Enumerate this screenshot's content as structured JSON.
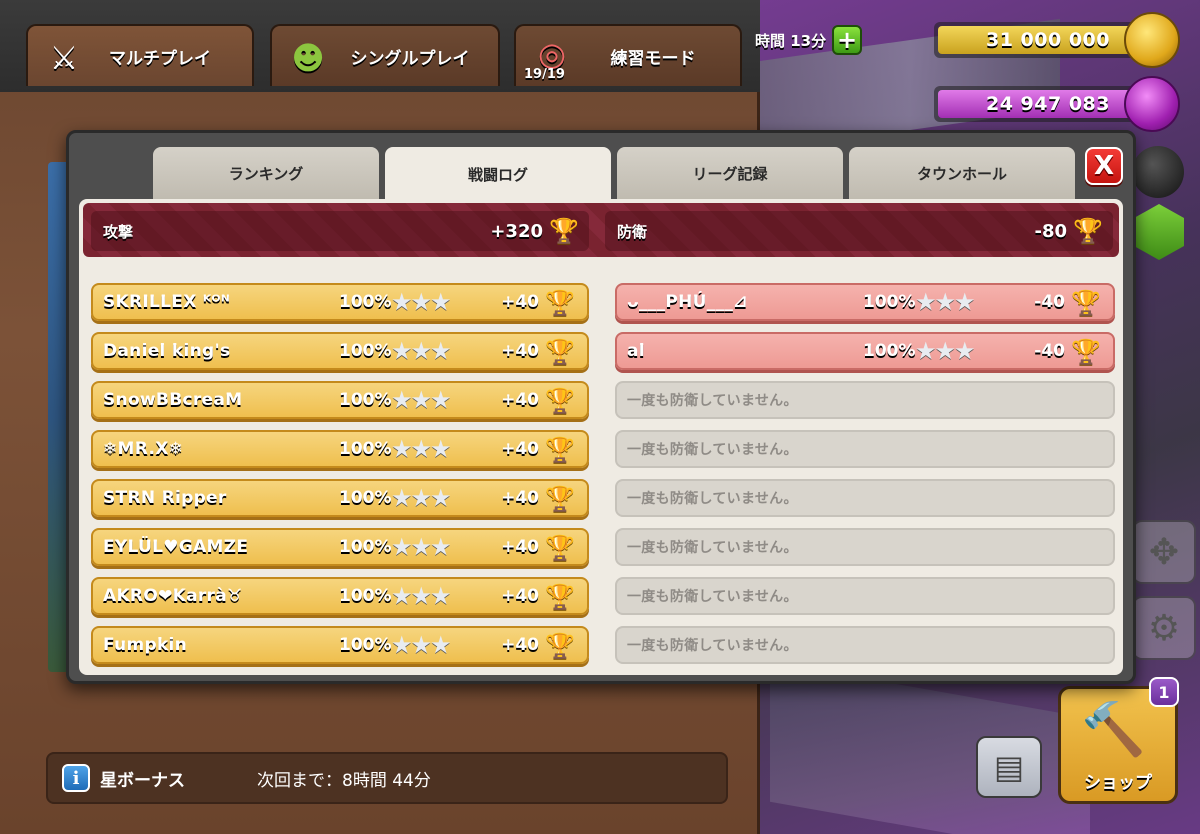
{
  "top_tabs": [
    {
      "label": "マルチプレイ",
      "icon": "crossed-swords-icon"
    },
    {
      "label": "シングルプレイ",
      "icon": "goblin-icon"
    },
    {
      "label": "練習モード",
      "icon": "target-icon",
      "count": "19/19"
    }
  ],
  "hud": {
    "time_label": "時間 13分",
    "gold": "31 000 000",
    "elixir": "24 947 083"
  },
  "dialog": {
    "tabs": [
      "ランキング",
      "戦闘ログ",
      "リーグ記録",
      "タウンホール"
    ],
    "active_tab": "戦闘ログ",
    "close_label": "X",
    "attack": {
      "label": "攻撃",
      "total": "+320"
    },
    "defense": {
      "label": "防衛",
      "total": "-80"
    },
    "attacks": [
      {
        "name": "SKRILLEX ᴷᴼᴺ",
        "percent": "100%",
        "stars": "★★★",
        "trophies": "+40"
      },
      {
        "name": "Daniel king's",
        "percent": "100%",
        "stars": "★★★",
        "trophies": "+40"
      },
      {
        "name": "SnowBBcreaM",
        "percent": "100%",
        "stars": "★★★",
        "trophies": "+40"
      },
      {
        "name": "❄MR.X❄",
        "percent": "100%",
        "stars": "★★★",
        "trophies": "+40"
      },
      {
        "name": "STRN Ripper",
        "percent": "100%",
        "stars": "★★★",
        "trophies": "+40"
      },
      {
        "name": "EYLÜL♥GAMZE",
        "percent": "100%",
        "stars": "★★★",
        "trophies": "+40"
      },
      {
        "name": "AKRO❤Karrà♉",
        "percent": "100%",
        "stars": "★★★",
        "trophies": "+40"
      },
      {
        "name": "Fumpkin",
        "percent": "100%",
        "stars": "★★★",
        "trophies": "+40"
      }
    ],
    "defenses": [
      {
        "name": "ᴗ___PHÚ___⊿",
        "percent": "100%",
        "stars": "★★★",
        "trophies": "-40"
      },
      {
        "name": "al",
        "percent": "100%",
        "stars": "★★★",
        "trophies": "-40"
      }
    ],
    "empty_defense_text": "一度も防衛していません。"
  },
  "star_bonus": {
    "label": "星ボーナス",
    "next": "次回まで：8時間 44分"
  },
  "shop": {
    "label": "ショップ",
    "badge": "1"
  },
  "colors": {
    "attack_row": "#efbf4e",
    "defense_row": "#ee9a94",
    "summary_bar": "#7a2330",
    "close_button": "#e0241f"
  }
}
